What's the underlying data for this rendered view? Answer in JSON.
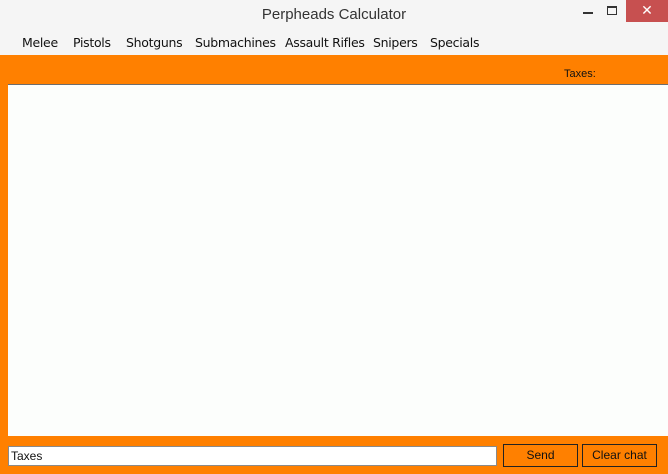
{
  "window": {
    "title": "Perpheads Calculator",
    "close_glyph": "✕"
  },
  "menu": [
    {
      "label": "Melee"
    },
    {
      "label": "Pistols"
    },
    {
      "label": "Shotguns"
    },
    {
      "label": "Submachines"
    },
    {
      "label": "Assault Rifles"
    },
    {
      "label": "Snipers"
    },
    {
      "label": "Specials"
    }
  ],
  "header": {
    "taxes_label": "Taxes:"
  },
  "chat": {
    "input_value": "Taxes",
    "send_label": "Send",
    "clear_label": "Clear chat"
  },
  "colors": {
    "accent": "#ff8000",
    "chat_background": "#fcfefc",
    "titlebar": "#f5f5f5",
    "close_button": "#c75050"
  }
}
